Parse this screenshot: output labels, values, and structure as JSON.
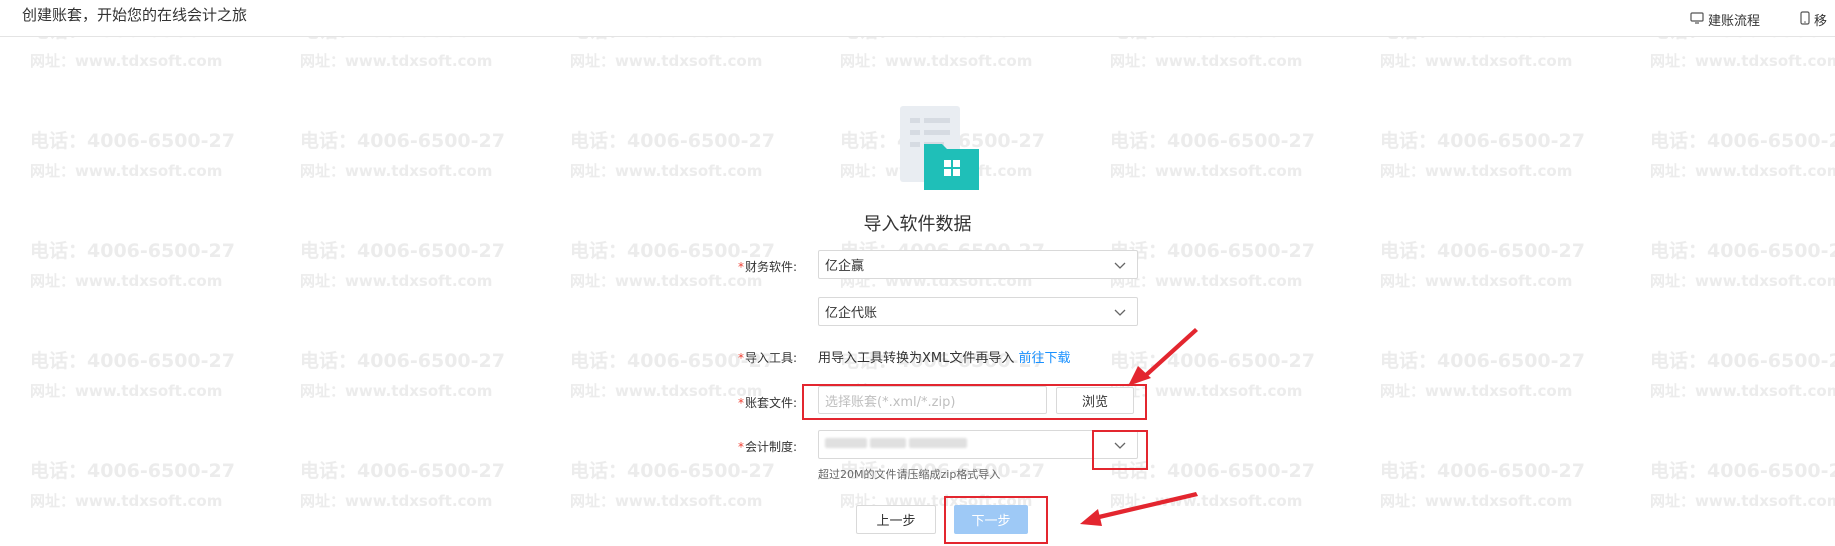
{
  "header": {
    "title": "创建账套，开始您的在线会计之旅",
    "links": [
      "建账流程",
      "移"
    ]
  },
  "watermark": {
    "phone": "电话：4006-6500-27",
    "url": "网址：www.tdxsoft.com"
  },
  "main": {
    "heading": "导入软件数据",
    "fields": {
      "software_label": "财务软件:",
      "software_value": "亿企赢",
      "software_sub_value": "亿企代账",
      "tool_label": "导入工具:",
      "tool_text": "用导入工具转换为XML文件再导入",
      "tool_link": "前往下载",
      "file_label": "账套文件:",
      "file_placeholder": "选择账套(*.xml/*.zip)",
      "browse_label": "浏览",
      "system_label": "会计制度:",
      "note": "超过20M的文件请压缩成zip格式导入"
    },
    "buttons": {
      "prev": "上一步",
      "next": "下一步"
    }
  },
  "colors": {
    "annotation": "#e3262f",
    "primary_disabled": "#9ec9f6",
    "link": "#1890ff",
    "teal_folder": "#1fbfb8"
  }
}
